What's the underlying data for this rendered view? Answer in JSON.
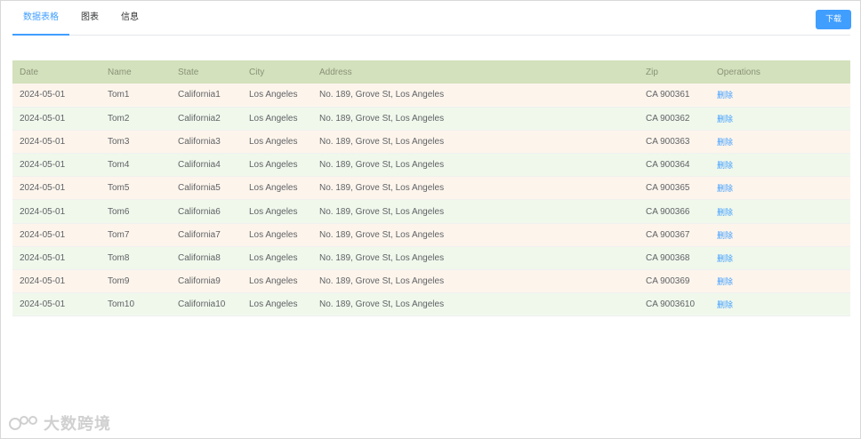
{
  "tabs": [
    {
      "label": "数据表格"
    },
    {
      "label": "图表"
    },
    {
      "label": "信息"
    }
  ],
  "download_label": "下载",
  "table": {
    "columns": [
      "Date",
      "Name",
      "State",
      "City",
      "Address",
      "Zip",
      "Operations"
    ],
    "rows": [
      {
        "date": "2024-05-01",
        "name": "Tom1",
        "state": "California1",
        "city": "Los Angeles",
        "address": "No. 189, Grove St, Los Angeles",
        "zip": "CA 900361",
        "op": "删除"
      },
      {
        "date": "2024-05-01",
        "name": "Tom2",
        "state": "California2",
        "city": "Los Angeles",
        "address": "No. 189, Grove St, Los Angeles",
        "zip": "CA 900362",
        "op": "删除"
      },
      {
        "date": "2024-05-01",
        "name": "Tom3",
        "state": "California3",
        "city": "Los Angeles",
        "address": "No. 189, Grove St, Los Angeles",
        "zip": "CA 900363",
        "op": "删除"
      },
      {
        "date": "2024-05-01",
        "name": "Tom4",
        "state": "California4",
        "city": "Los Angeles",
        "address": "No. 189, Grove St, Los Angeles",
        "zip": "CA 900364",
        "op": "删除"
      },
      {
        "date": "2024-05-01",
        "name": "Tom5",
        "state": "California5",
        "city": "Los Angeles",
        "address": "No. 189, Grove St, Los Angeles",
        "zip": "CA 900365",
        "op": "删除"
      },
      {
        "date": "2024-05-01",
        "name": "Tom6",
        "state": "California6",
        "city": "Los Angeles",
        "address": "No. 189, Grove St, Los Angeles",
        "zip": "CA 900366",
        "op": "删除"
      },
      {
        "date": "2024-05-01",
        "name": "Tom7",
        "state": "California7",
        "city": "Los Angeles",
        "address": "No. 189, Grove St, Los Angeles",
        "zip": "CA 900367",
        "op": "删除"
      },
      {
        "date": "2024-05-01",
        "name": "Tom8",
        "state": "California8",
        "city": "Los Angeles",
        "address": "No. 189, Grove St, Los Angeles",
        "zip": "CA 900368",
        "op": "删除"
      },
      {
        "date": "2024-05-01",
        "name": "Tom9",
        "state": "California9",
        "city": "Los Angeles",
        "address": "No. 189, Grove St, Los Angeles",
        "zip": "CA 900369",
        "op": "删除"
      },
      {
        "date": "2024-05-01",
        "name": "Tom10",
        "state": "California10",
        "city": "Los Angeles",
        "address": "No. 189, Grove St, Los Angeles",
        "zip": "CA 9003610",
        "op": "删除"
      }
    ]
  },
  "watermark_text": "大数跨境",
  "colors": {
    "accent": "#409eff",
    "header_bg": "#d3e1bc",
    "row_odd_bg": "#fdf5ec",
    "row_even_bg": "#f0f8ec"
  }
}
